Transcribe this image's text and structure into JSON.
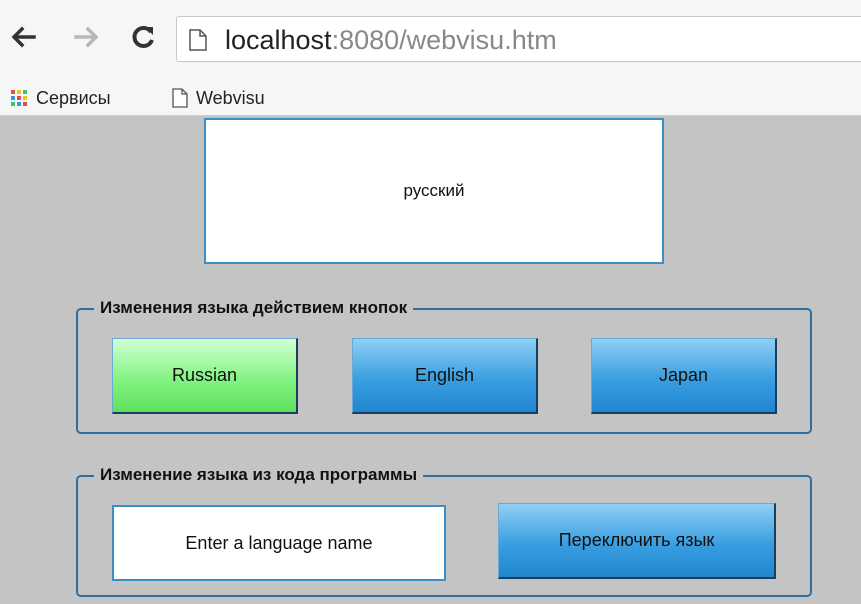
{
  "browser": {
    "url_host": "localhost",
    "url_rest": ":8080/webvisu.htm",
    "bookmarks": [
      {
        "label": "Сервисы"
      },
      {
        "label": "Webvisu"
      }
    ]
  },
  "visu": {
    "current_language": "русский",
    "group_buttons": {
      "title": "Изменения языка действием кнопок",
      "buttons": [
        {
          "label": "Russian",
          "active": true
        },
        {
          "label": "English",
          "active": false
        },
        {
          "label": "Japan",
          "active": false
        }
      ]
    },
    "group_code": {
      "title": "Изменение языка из кода программы",
      "input_placeholder": "Enter a language name",
      "switch_label": "Переключить язык"
    }
  },
  "colors": {
    "accent_blue": "#3a9ee0",
    "active_green": "#7ef27e",
    "frame_border": "#2f6f9f",
    "background": "#c4c4c4"
  }
}
